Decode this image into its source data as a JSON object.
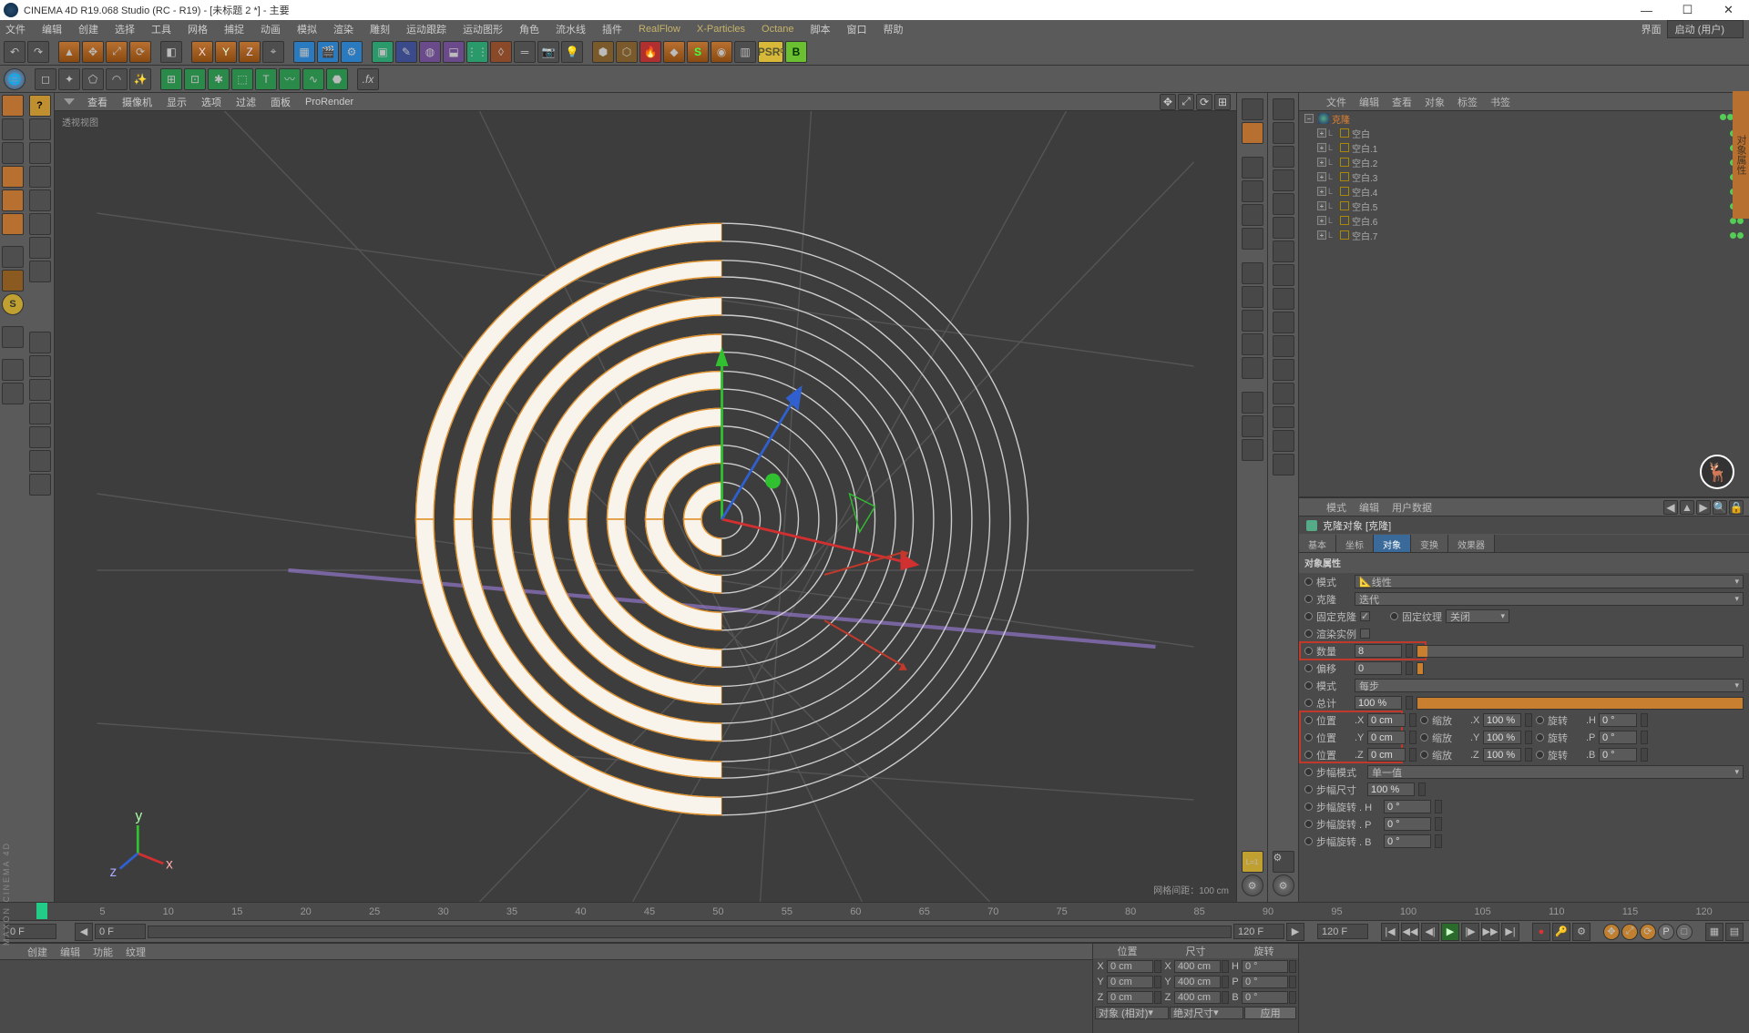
{
  "title": "CINEMA 4D R19.068 Studio (RC - R19) - [未标题 2 *] - 主要",
  "layout_label": "界面",
  "layout_value": "启动 (用户)",
  "menus": [
    "文件",
    "编辑",
    "创建",
    "选择",
    "工具",
    "网格",
    "捕捉",
    "动画",
    "模拟",
    "渲染",
    "雕刻",
    "运动跟踪",
    "运动图形",
    "角色",
    "流水线",
    "插件",
    "RealFlow",
    "X-Particles",
    "Octane",
    "脚本",
    "窗口",
    "帮助"
  ],
  "vp_menu": [
    "查看",
    "摄像机",
    "显示",
    "选项",
    "过滤",
    "面板",
    "ProRender"
  ],
  "vp_label": "透视视图",
  "grid_info": "网格间距：100 cm",
  "om_tabs": [
    "文件",
    "编辑",
    "查看",
    "对象",
    "标签",
    "书签"
  ],
  "tree": {
    "root": "克隆",
    "children": [
      "空白",
      "空白.1",
      "空白.2",
      "空白.3",
      "空白.4",
      "空白.5",
      "空白.6",
      "空白.7"
    ]
  },
  "attr_tabs_bar": [
    "模式",
    "编辑",
    "用户数据"
  ],
  "attr_title": "克隆对象 [克隆]",
  "attr_tabs": [
    "基本",
    "坐标",
    "对象",
    "变换",
    "效果器"
  ],
  "attr_tabs_active": 2,
  "attr_section": "对象属性",
  "attr": {
    "mode_label": "模式",
    "mode_value": "线性",
    "clone_label": "克隆",
    "clone_value": "迭代",
    "fixclone_label": "固定克隆",
    "fixclone_checked": true,
    "fixtex_label": "固定纹理",
    "fixtex_value": "关闭",
    "renderinst_label": "渲染实例",
    "count_label": "数量",
    "count_value": "8",
    "offset_label": "偏移",
    "offset_value": "0",
    "mode2_label": "模式",
    "mode2_value": "每步",
    "total_label": "总计",
    "total_value": "100 %",
    "pos_label": "位置",
    "pos_x": "0 cm",
    "pos_y": "0 cm",
    "pos_z": "0 cm",
    "scale_label": "缩放",
    "scale_x": "100 %",
    "scale_y": "100 %",
    "scale_z": "100 %",
    "rot_label": "旋转",
    "rot_h": "0 °",
    "rot_p": "0 °",
    "rot_b": "0 °",
    "stepmode_label": "步幅模式",
    "stepmode_value": "单一值",
    "stepsize_label": "步幅尺寸",
    "stepsize_value": "100 %",
    "steprot_label": "步幅旋转",
    "steprot_h_label": "步幅旋转 . H",
    "steprot_h": "0 °",
    "steprot_p_label": "步幅旋转 . P",
    "steprot_p": "0 °",
    "steprot_b_label": "步幅旋转 . B",
    "steprot_b": "0 °"
  },
  "timeline_ticks": [
    "0",
    "5",
    "10",
    "15",
    "20",
    "25",
    "30",
    "35",
    "40",
    "45",
    "50",
    "55",
    "60",
    "65",
    "70",
    "75",
    "80",
    "85",
    "90",
    "95",
    "100",
    "105",
    "110",
    "115",
    "120"
  ],
  "transport": {
    "start": "0 F",
    "cur": "0 F",
    "end": "120 F",
    "end2": "120 F"
  },
  "matpane_tabs": [
    "创建",
    "编辑",
    "功能",
    "纹理"
  ],
  "coord": {
    "hdr": [
      "位置",
      "尺寸",
      "旋转"
    ],
    "x": "0 cm",
    "sx": "400 cm",
    "rh": "0 °",
    "y": "0 cm",
    "sy": "400 cm",
    "rp": "0 °",
    "z": "0 cm",
    "sz": "400 cm",
    "rb": "0 °",
    "obj_label": "对象 (相对)",
    "size_label": "绝对尺寸",
    "apply": "应用",
    "axes": {
      "x": "X",
      "y": "Y",
      "z": "Z",
      "h": "H",
      "p": "P",
      "b": "B"
    }
  },
  "sidevert": "对象属性"
}
